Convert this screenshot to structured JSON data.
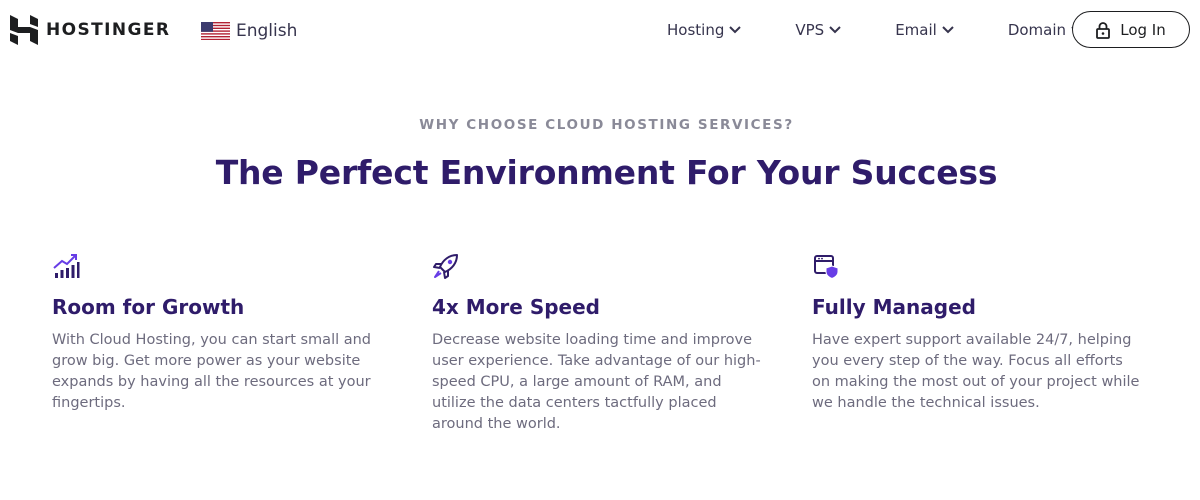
{
  "header": {
    "logo_text": "HOSTINGER",
    "language": "English",
    "nav": [
      {
        "label": "Hosting"
      },
      {
        "label": "VPS"
      },
      {
        "label": "Email"
      },
      {
        "label": "Domain"
      }
    ],
    "login_label": "Log In"
  },
  "hero": {
    "eyebrow": "WHY CHOOSE CLOUD HOSTING SERVICES?",
    "title": "The Perfect Environment For Your Success"
  },
  "features": [
    {
      "icon": "growth-chart-icon",
      "title": "Room for Growth",
      "text": "With Cloud Hosting, you can start small and grow big. Get more power as your website expands by having all the resources at your fingertips."
    },
    {
      "icon": "rocket-icon",
      "title": "4x More Speed",
      "text": "Decrease website loading time and improve user experience. Take advantage of our high-speed CPU, a large amount of RAM, and utilize the data centers tactfully placed around the world."
    },
    {
      "icon": "managed-shield-icon",
      "title": "Fully Managed",
      "text": "Have expert support available 24/7, helping you every step of the way. Focus all efforts on making the most out of your project while we handle the technical issues."
    }
  ],
  "colors": {
    "brand_purple": "#673de6",
    "heading_navy": "#2f1c6a",
    "body_text": "#6d6b7e"
  }
}
